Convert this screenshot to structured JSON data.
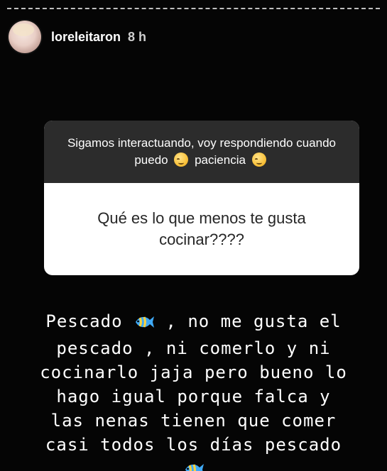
{
  "story": {
    "username": "loreleitaron",
    "time_ago": "8 h"
  },
  "question_sticker": {
    "prompt_part1": "Sigamos interactuando, voy respondiendo cuando puedo",
    "prompt_part2": "paciencia",
    "question": "Qué es lo que menos te gusta cocinar????"
  },
  "answer": {
    "line1_a": "Pescado",
    "line1_b": ", no me gusta el",
    "line2": "pescado , ni comerlo y ni",
    "line3": "cocinarlo jaja pero bueno lo",
    "line4": "hago igual porque falca y",
    "line5": "las nenas tienen que comer",
    "line6": "casi todos los días pescado"
  },
  "icons": {
    "emoji": "relieved-face-icon",
    "fish": "tropical-fish-icon"
  }
}
